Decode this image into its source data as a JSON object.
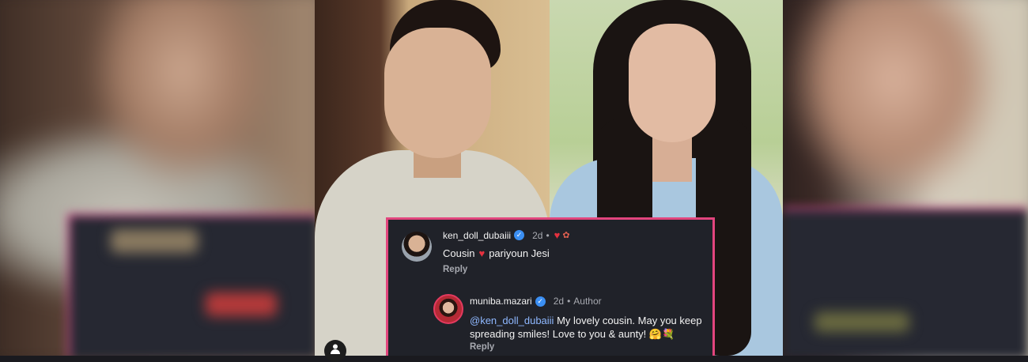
{
  "comments": [
    {
      "username": "ken_doll_dubaiii",
      "time": "2d",
      "separator": "•",
      "reaction_icons": [
        "heart-icon",
        "rose-icon"
      ],
      "text_before": "Cousin",
      "text_after": "pariyoun Jesi",
      "reply_label": "Reply",
      "reply": {
        "username": "muniba.mazari",
        "time": "2d",
        "separator": "•",
        "author_label": "Author",
        "mention": "@ken_doll_dubaiii",
        "text_line1": "My lovely cousin. May you keep",
        "text_line2": "spreading smiles! Love to you & aunty!",
        "emojis": "🤗💐",
        "reply_label": "Reply"
      }
    }
  ],
  "colors": {
    "card_border": "#e2457d",
    "card_background": "#202229",
    "verified": "#3b8ff3",
    "mention": "#8fb8ff"
  }
}
